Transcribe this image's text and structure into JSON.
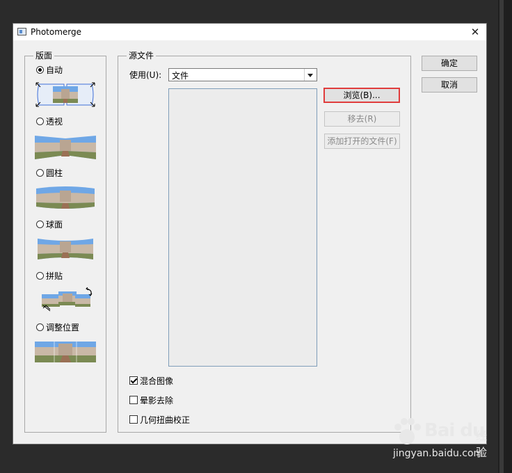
{
  "window": {
    "title": "Photomerge",
    "close_glyph": "✕",
    "icon": "photomerge-app-icon"
  },
  "layout": {
    "label": "版面",
    "options": [
      {
        "label": "自动",
        "checked": true
      },
      {
        "label": "透视",
        "checked": false
      },
      {
        "label": "圆柱",
        "checked": false
      },
      {
        "label": "球面",
        "checked": false
      },
      {
        "label": "拼贴",
        "checked": false
      },
      {
        "label": "调整位置",
        "checked": false
      }
    ]
  },
  "source": {
    "label": "源文件",
    "use_label": "使用(U):",
    "use_value": "文件",
    "browse": "浏览(B)...",
    "remove": "移去(R)",
    "add_open": "添加打开的文件(F)"
  },
  "options": {
    "blend": {
      "label": "混合图像",
      "checked": true
    },
    "vignette": {
      "label": "晕影去除",
      "checked": false
    },
    "geometric": {
      "label": "几何扭曲校正",
      "checked": false
    }
  },
  "actions": {
    "ok": "确定",
    "cancel": "取消"
  },
  "watermark": {
    "brand": "Bai du",
    "cn": "经验",
    "url": "jingyan.baidu.com"
  },
  "colors": {
    "focus_highlight": "#e03c3c",
    "selection_blue": "#3f6fd8",
    "sky": "#6fa7e6",
    "building": "#c9b8a6",
    "ground": "#7b8a53"
  }
}
